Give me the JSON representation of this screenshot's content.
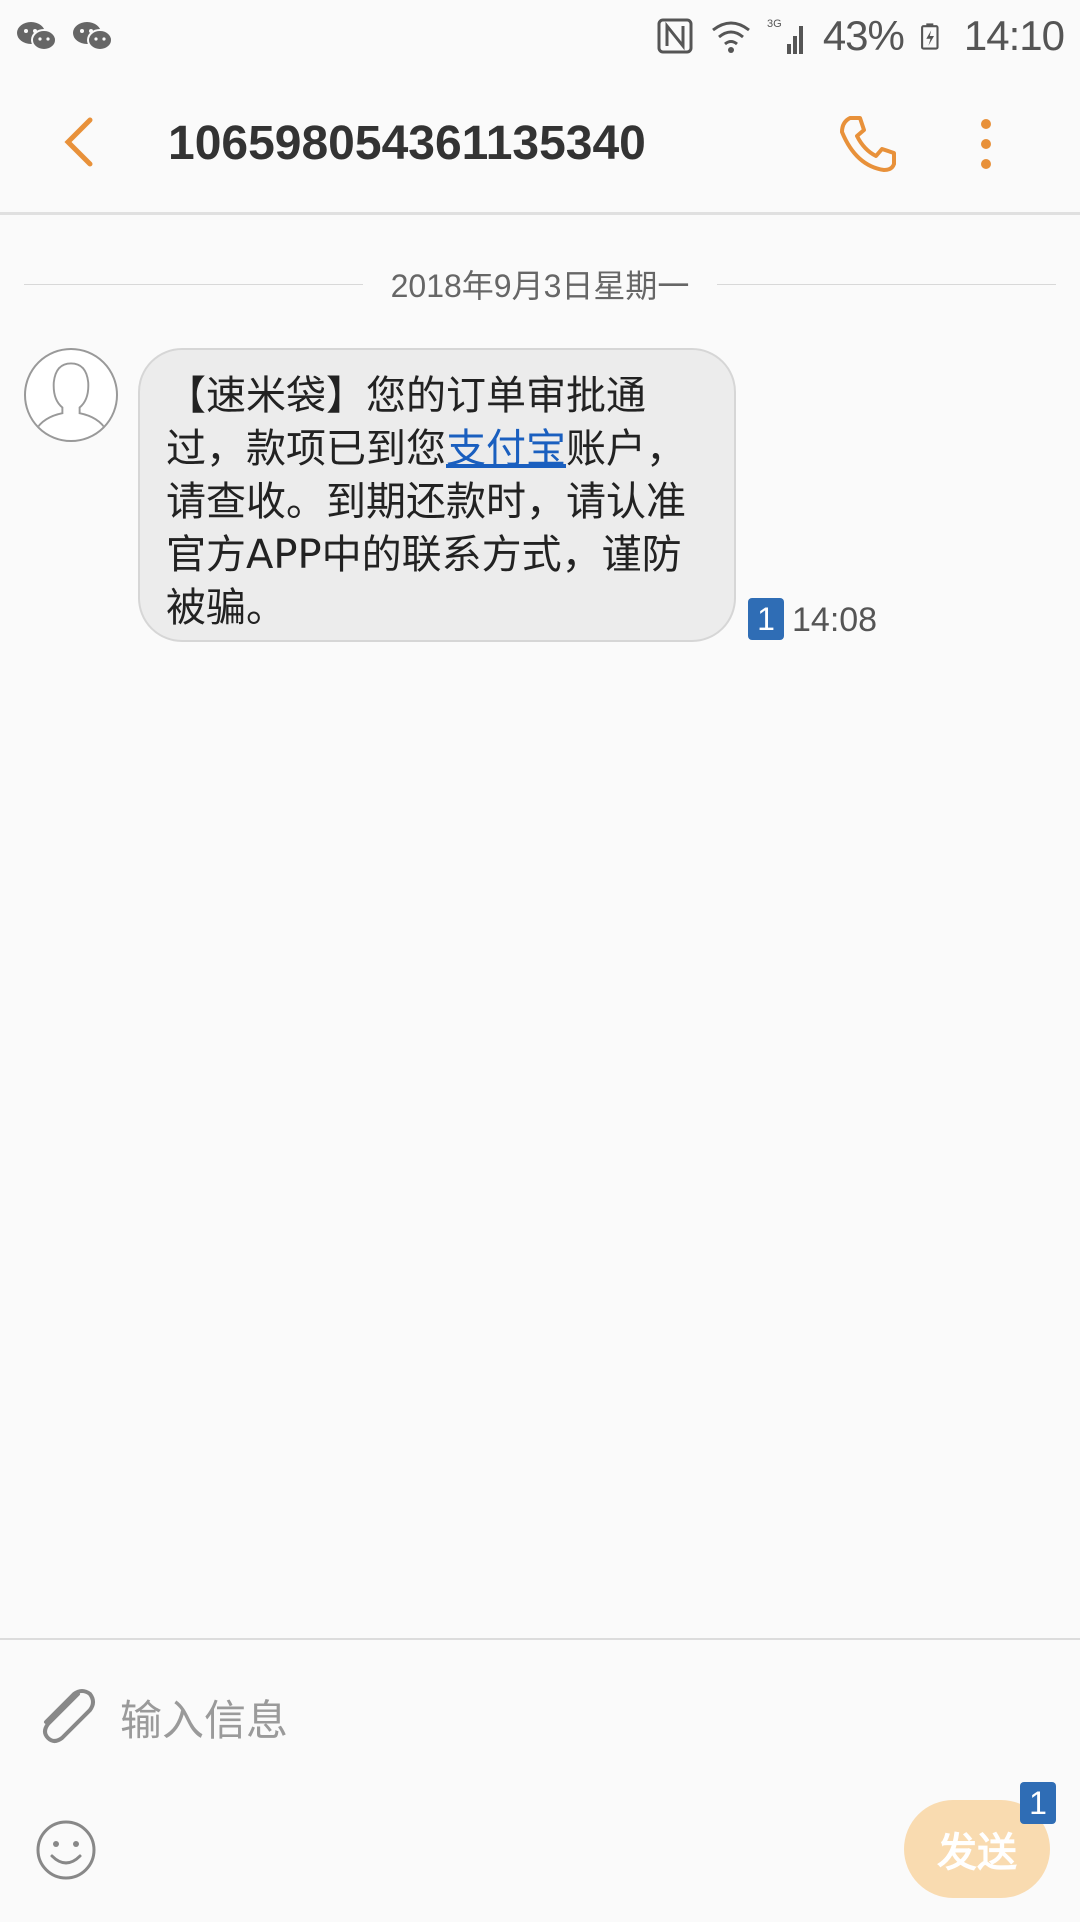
{
  "status_bar": {
    "battery": "43%",
    "time": "14:10",
    "network": "3G",
    "icons": [
      "wechat-icon",
      "wechat-icon",
      "nfc-icon",
      "wifi-icon",
      "signal-icon",
      "battery-icon"
    ]
  },
  "header": {
    "title": "106598054361135340",
    "back_icon": "back-icon",
    "call_icon": "phone-icon",
    "more_icon": "more-vertical-icon"
  },
  "conversation": {
    "date": "2018年9月3日星期一",
    "messages": [
      {
        "text_before_link": "【速米袋】您的订单审批通过，款项已到您",
        "link_text": "支付宝",
        "text_after_link": "账户，请查收。到期还款时，请认准官方APP中的联系方式，谨防被骗。",
        "sim": "1",
        "time": "14:08"
      }
    ]
  },
  "composer": {
    "placeholder": "输入信息",
    "send_label": "发送",
    "sim": "1",
    "attach_icon": "paperclip-icon",
    "emoji_icon": "smiley-icon"
  },
  "colors": {
    "accent": "#e8913a",
    "link": "#1a5fbf",
    "sim_badge": "#2f6db5",
    "send_button": "#f9dbb0"
  }
}
